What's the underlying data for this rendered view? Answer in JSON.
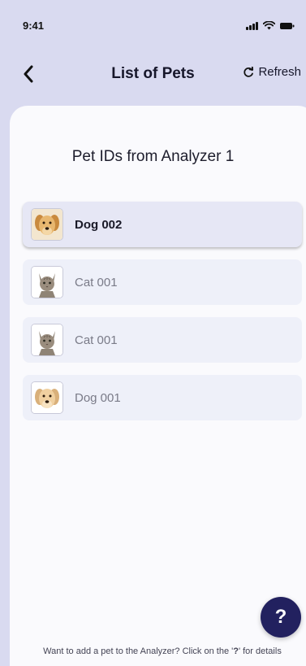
{
  "status_bar": {
    "time": "9:41",
    "icons": [
      "signal-icon",
      "wifi-icon",
      "battery-icon"
    ]
  },
  "nav": {
    "back_icon": "chevron-left-icon",
    "title": "List of Pets",
    "refresh_icon": "refresh-icon",
    "refresh_label": "Refresh"
  },
  "section": {
    "title": "Pet IDs from Analyzer 1"
  },
  "pets": [
    {
      "label": "Dog 002",
      "thumb": "dog",
      "selected": true
    },
    {
      "label": "Cat 001",
      "thumb": "cat",
      "selected": false
    },
    {
      "label": "Cat 001",
      "thumb": "cat",
      "selected": false
    },
    {
      "label": "Dog 001",
      "thumb": "dog",
      "selected": false
    }
  ],
  "help": {
    "label": "?",
    "icon": "help-icon"
  },
  "footer": {
    "hint_prefix": "Want to add a pet to the Analyzer? Click on the '",
    "hint_symbol": "?",
    "hint_suffix": "' for details"
  },
  "colors": {
    "header_bg": "#d9daf0",
    "sheet_bg": "#fafafd",
    "item_bg": "#eef0f9",
    "fab_bg": "#22215f"
  }
}
